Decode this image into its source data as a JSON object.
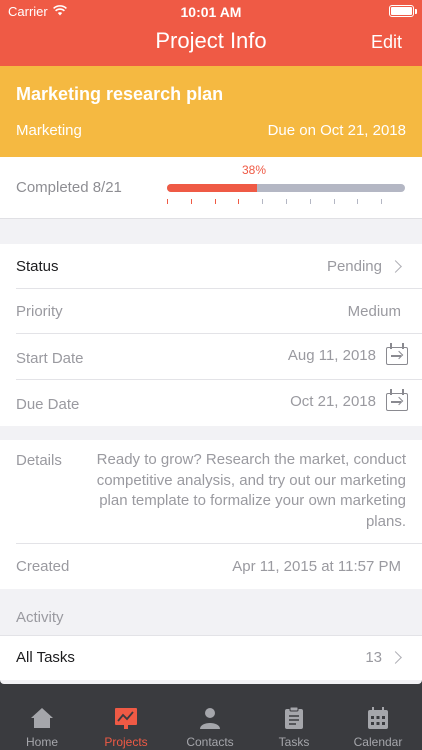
{
  "status_bar": {
    "carrier": "Carrier",
    "time": "10:01 AM"
  },
  "nav": {
    "title": "Project Info",
    "edit_label": "Edit"
  },
  "project": {
    "name": "Marketing research plan",
    "category": "Marketing",
    "due_text": "Due on Oct 21, 2018"
  },
  "progress": {
    "label": "Completed 8/21",
    "percent_text": "38%",
    "fraction": 0.38
  },
  "fields": {
    "status": {
      "label": "Status",
      "value": "Pending"
    },
    "priority": {
      "label": "Priority",
      "value": "Medium"
    },
    "start_date": {
      "label": "Start Date",
      "value": "Aug 11, 2018"
    },
    "due_date": {
      "label": "Due Date",
      "value": "Oct 21, 2018"
    }
  },
  "details": {
    "label": "Details",
    "text": "Ready to grow? Research the market, conduct competitive analysis, and try out our marketing plan template to formalize your own marketing plans."
  },
  "created": {
    "label": "Created",
    "value": "Apr 11, 2015 at 11:57 PM"
  },
  "activity": {
    "header": "Activity",
    "all_tasks": {
      "label": "All Tasks",
      "count": "13"
    }
  },
  "tabs": [
    {
      "label": "Home",
      "icon": "home-icon",
      "active": false
    },
    {
      "label": "Projects",
      "icon": "projects-icon",
      "active": true
    },
    {
      "label": "Contacts",
      "icon": "contacts-icon",
      "active": false
    },
    {
      "label": "Tasks",
      "icon": "tasks-icon",
      "active": false
    },
    {
      "label": "Calendar",
      "icon": "calendar-icon",
      "active": false
    }
  ],
  "colors": {
    "accent": "#ef5a45",
    "header_yellow": "#f5b941",
    "progress_track": "#b4b7c4",
    "tab_bar": "#3a3b3f"
  }
}
